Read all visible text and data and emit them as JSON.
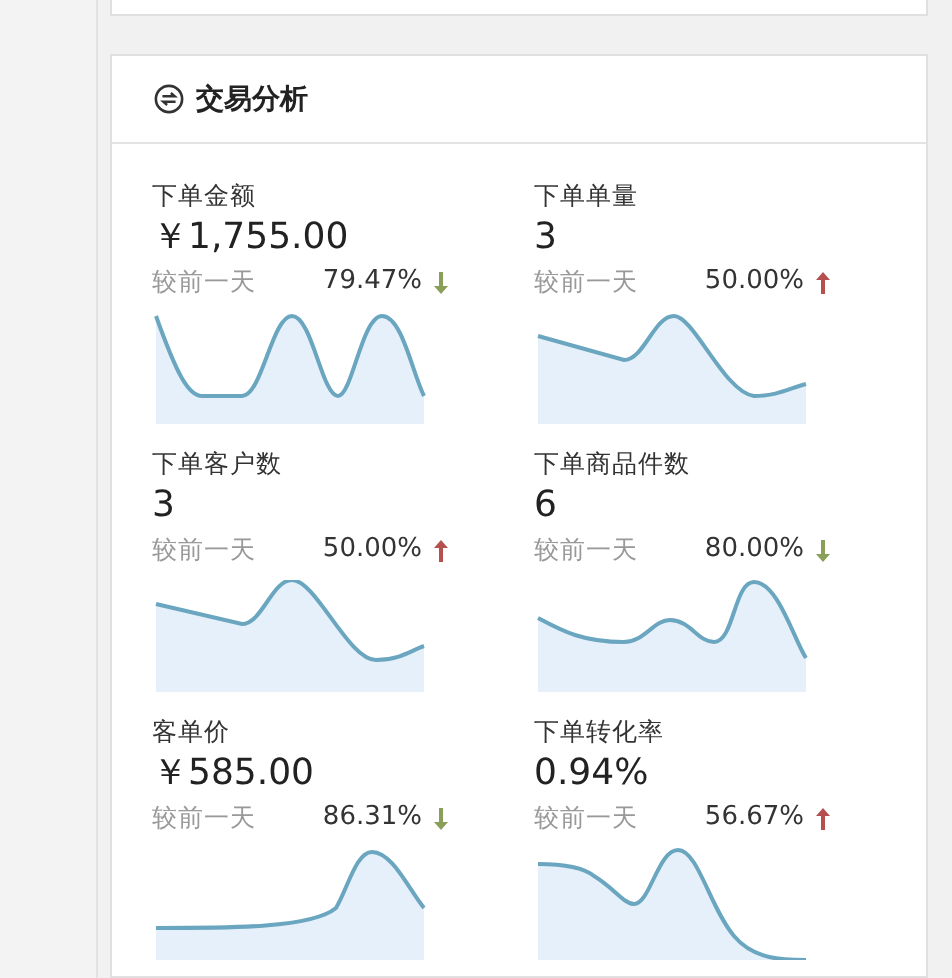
{
  "section": {
    "title": "交易分析"
  },
  "metrics": [
    {
      "label": "下单金额",
      "value": "￥1,755.00",
      "compare_label": "较前一天",
      "change": "79.47%",
      "increase": false
    },
    {
      "label": "下单单量",
      "value": "3",
      "compare_label": "较前一天",
      "change": "50.00%",
      "increase": true
    },
    {
      "label": "下单客户数",
      "value": "3",
      "compare_label": "较前一天",
      "change": "50.00%",
      "increase": true
    },
    {
      "label": "下单商品件数",
      "value": "6",
      "compare_label": "较前一天",
      "change": "80.00%",
      "increase": false
    },
    {
      "label": "客单价",
      "value": "￥585.00",
      "compare_label": "较前一天",
      "change": "86.31%",
      "increase": false
    },
    {
      "label": "下单转化率",
      "value": "0.94%",
      "compare_label": "较前一天",
      "change": "56.67%",
      "increase": true
    }
  ]
}
